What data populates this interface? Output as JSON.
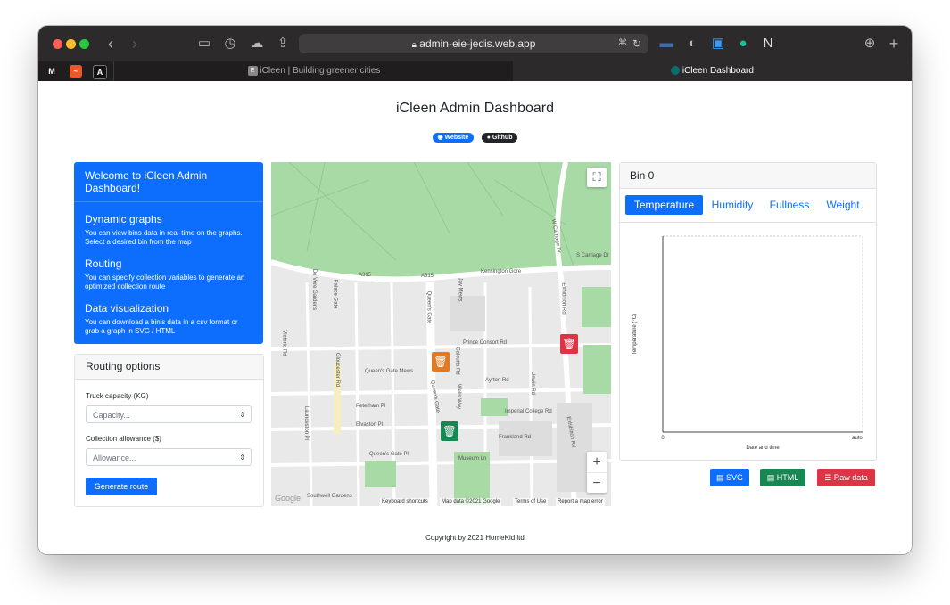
{
  "browser": {
    "url": "admin-eie-jedis.web.app",
    "tabs": [
      {
        "label": "iCleen | Building greener cities"
      },
      {
        "label": "iCleen Dashboard"
      }
    ],
    "pinned": [
      {
        "label": "M",
        "color": "#6e6e6e"
      },
      {
        "label": "~",
        "color": "#f0552b"
      },
      {
        "label": "A",
        "color": "#111111"
      }
    ]
  },
  "page": {
    "title": "iCleen Admin Dashboard",
    "badges": [
      {
        "label": "Website",
        "color": "#0d6efd"
      },
      {
        "label": "Github",
        "color": "#212529"
      }
    ]
  },
  "welcome": {
    "title": "Welcome to iCleen Admin Dashboard!",
    "sections": [
      {
        "heading": "Dynamic graphs",
        "text": "You can view bins data in real-time on the graphs. Select a desired bin from the map"
      },
      {
        "heading": "Routing",
        "text": "You can specify collection variables to generate an optimized collection route"
      },
      {
        "heading": "Data visualization",
        "text": "You can download a bin's data in a csv format or grab a graph in SVG / HTML"
      }
    ]
  },
  "routing": {
    "title": "Routing options",
    "capacity_label": "Truck capacity (KG)",
    "capacity_placeholder": "Capacity...",
    "allowance_label": "Collection allowance ($)",
    "allowance_placeholder": "Allowance...",
    "generate_label": "Generate route"
  },
  "map": {
    "labels": [
      "A315",
      "A315",
      "Kensington Gore",
      "Queen's Gate",
      "Queen's Gate",
      "Exhibition Rd",
      "Exhibition Rd",
      "Prince Consort Rd",
      "Imperial College Rd",
      "Frankland Rd",
      "Ayrton Rd",
      "Queen's Gate Mews",
      "Peterham Pl",
      "Elvaston Pl",
      "Queen's Gate Pl",
      "Museum Ln",
      "Southwell Gardens",
      "Gloucester Rd",
      "Victoria Rd",
      "De Vere Gardens",
      "Palace Gate",
      "W Carriage Dr",
      "S Carriage Dr",
      "Launceston Pl",
      "Jay Mews",
      "Calcutta Rd",
      "Wells Way",
      "Unwin Rd"
    ],
    "bins": [
      {
        "color": "#dc3545",
        "icon": "trash-icon"
      },
      {
        "color": "#e07b24",
        "icon": "trash-icon"
      },
      {
        "color": "#198754",
        "icon": "trash-icon"
      }
    ],
    "zoom_in": "+",
    "zoom_out": "−",
    "attribution": [
      "Keyboard shortcuts",
      "Map data ©2021 Google",
      "Terms of Use",
      "Report a map error"
    ],
    "logo": "Google"
  },
  "bin": {
    "title": "Bin 0",
    "tabs": [
      "Temperature",
      "Humidity",
      "Fullness",
      "Weight"
    ],
    "chart": {
      "ylabel": "Temperature (°C)",
      "xlabel": "Date and time",
      "x_start": "0",
      "x_end": "auto"
    }
  },
  "chart_data": {
    "type": "line",
    "title": "",
    "xlabel": "Date and time",
    "ylabel": "Temperature (°C)",
    "series": [],
    "x": [],
    "x_ticks": [
      "0",
      "auto"
    ]
  },
  "actions": {
    "svg_label": "SVG",
    "html_label": "HTML",
    "raw_label": "Raw data"
  },
  "footer": {
    "text": "Copyright by 2021 HomeKid.ltd"
  }
}
